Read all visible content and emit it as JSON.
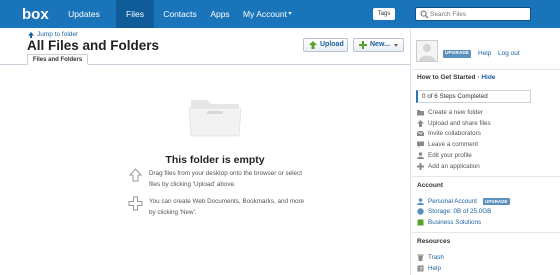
{
  "nav": {
    "logo": "box",
    "items": [
      {
        "label": "Updates",
        "active": false
      },
      {
        "label": "Files",
        "active": true
      },
      {
        "label": "Contacts",
        "active": false
      },
      {
        "label": "Apps",
        "active": false
      },
      {
        "label": "My Account",
        "active": false
      }
    ],
    "tags_label": "Tags",
    "search_placeholder": "Search Files"
  },
  "header": {
    "jump_link": "Jump to folder",
    "title": "All Files and Folders",
    "upload_label": "Upload",
    "new_label": "New...",
    "tab_label": "Files and Folders"
  },
  "empty": {
    "title": "This folder is empty",
    "hint_drag": "Drag files from your desktop onto the browser or select files by clicking 'Upload' above.",
    "hint_create": "You can create Web Documents, Bookmarks, and more by clicking 'New'."
  },
  "account_bar": {
    "upgrade_label": "UPGRADE",
    "help_label": "Help",
    "logout_label": "Log out"
  },
  "get_started": {
    "heading": "How to Get Started",
    "hide_label": "Hide",
    "progress_text": "0 of 6 Steps Completed",
    "steps": [
      {
        "label": "Create a new folder",
        "icon": "folder-add-icon"
      },
      {
        "label": "Upload and share files",
        "icon": "upload-icon"
      },
      {
        "label": "Invite collaborators",
        "icon": "envelope-icon"
      },
      {
        "label": "Leave a comment",
        "icon": "comment-icon"
      },
      {
        "label": "Edit your profile",
        "icon": "person-icon"
      },
      {
        "label": "Add an application",
        "icon": "plus-icon"
      }
    ]
  },
  "account": {
    "heading": "Account",
    "personal_label": "Personal Account",
    "personal_badge": "UPGRADE",
    "storage_label": "Storage: 0B of 25.0GB",
    "business_label": "Business Solutions"
  },
  "resources": {
    "heading": "Resources",
    "trash_label": "Trash",
    "help_label": "Help"
  },
  "colors": {
    "nav_bg": "#1a74ba",
    "nav_active": "#0f5c99",
    "link": "#1a5f9e",
    "green_icon": "#5aa02c"
  }
}
